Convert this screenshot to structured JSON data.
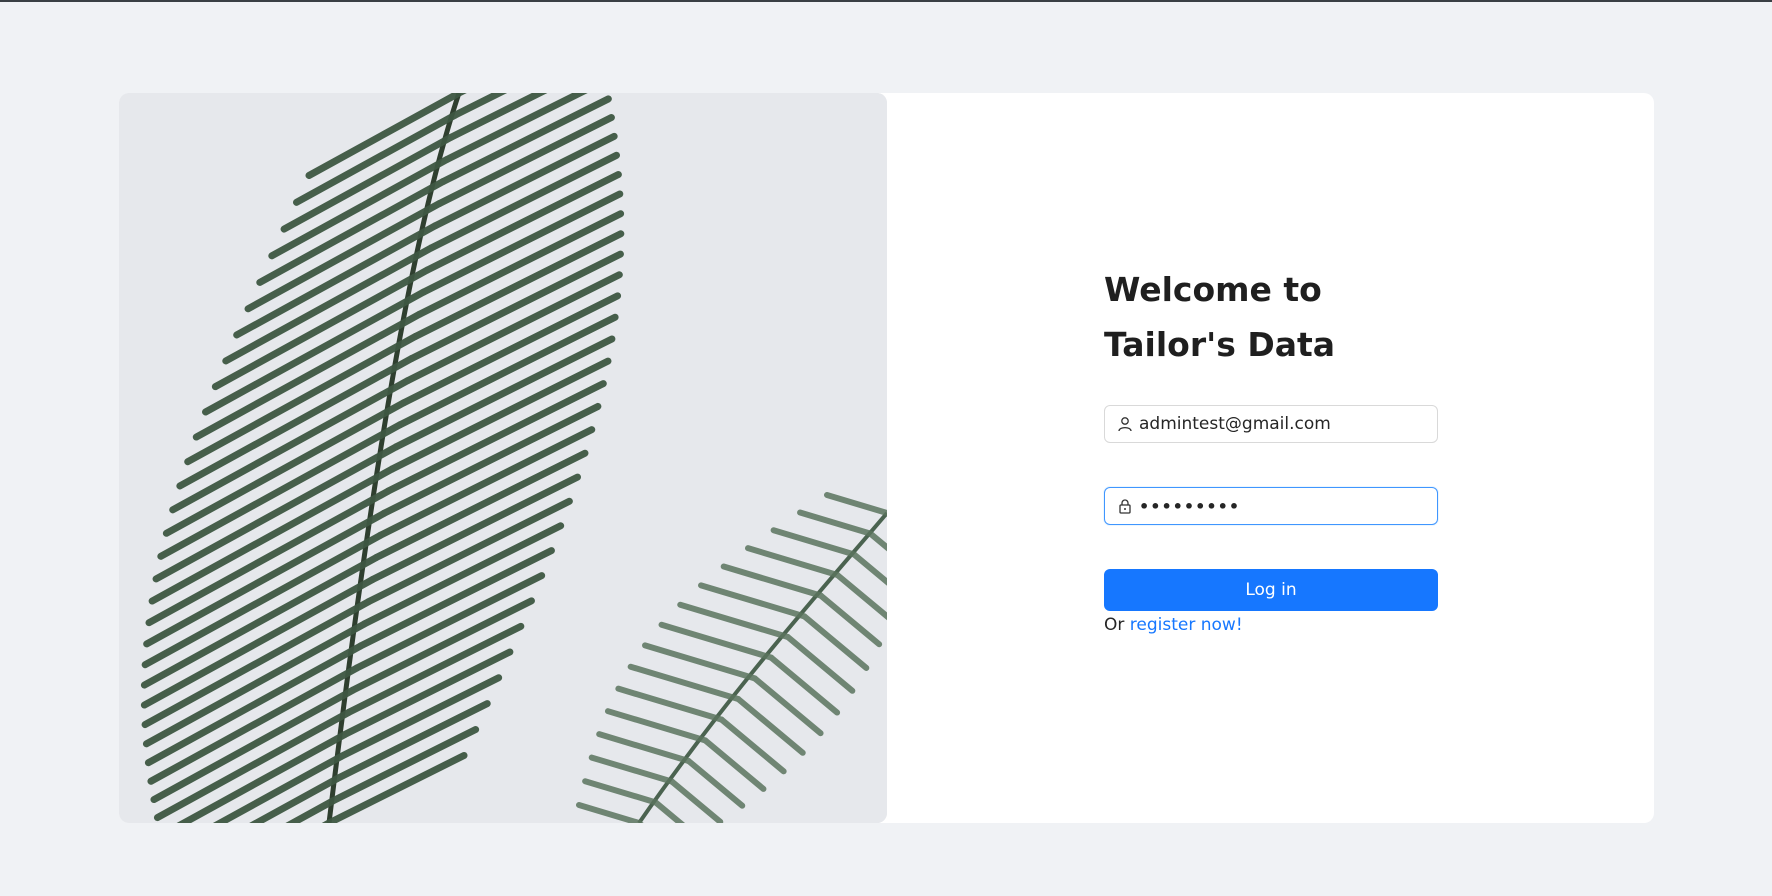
{
  "page": {
    "background": "#f0f2f5"
  },
  "hero_image": {
    "subject": "palm frond leaf",
    "background_color": "#e6e8ec",
    "leaf_color": "#3b5440"
  },
  "login": {
    "title": "Welcome to Tailor's Data",
    "email_icon": "user-icon",
    "email_value": "admintest@gmail.com",
    "password_icon": "lock-icon",
    "password_value": "•••••••••",
    "login_button": "Log in",
    "register_prefix": "Or",
    "register_link": "register now!",
    "accent_color": "#1677ff"
  }
}
